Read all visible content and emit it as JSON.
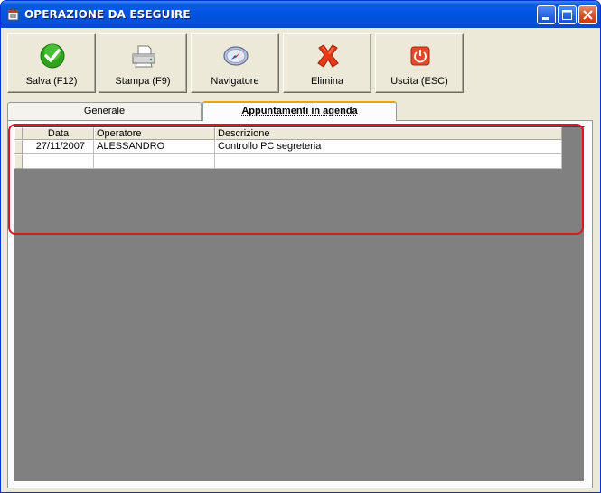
{
  "window": {
    "title": "OPERAZIONE DA ESEGUIRE"
  },
  "toolbar": {
    "buttons": [
      {
        "label": "Salva (F12)",
        "icon": "checkmark-icon"
      },
      {
        "label": "Stampa (F9)",
        "icon": "printer-icon"
      },
      {
        "label": "Navigatore",
        "icon": "compass-icon"
      },
      {
        "label": "Elimina",
        "icon": "delete-x-icon"
      },
      {
        "label": "Uscita (ESC)",
        "icon": "power-icon"
      }
    ]
  },
  "tabs": [
    {
      "label": "Generale",
      "active": false
    },
    {
      "label": "Appuntamenti in agenda",
      "active": true
    }
  ],
  "grid": {
    "columns": [
      "Data",
      "Operatore",
      "Descrizione"
    ],
    "rows": [
      {
        "data": "27/11/2007",
        "operatore": "ALESSANDRO",
        "descrizione": "Controllo PC segreteria"
      },
      {
        "data": "",
        "operatore": "",
        "descrizione": ""
      }
    ]
  },
  "colors": {
    "titlebar": "#0054e3",
    "highlight": "#e0161e",
    "grid_background": "#808080",
    "active_tab_accent": "#f5a10d"
  }
}
